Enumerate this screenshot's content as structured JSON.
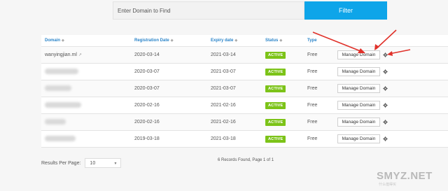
{
  "filter": {
    "placeholder": "Enter Domain to Find",
    "button_label": "Filter"
  },
  "table": {
    "headers": {
      "domain": "Domain",
      "registration_date": "Registration Date",
      "expiry_date": "Expiry date",
      "status": "Status",
      "type": "Type"
    },
    "rows": [
      {
        "domain": "wanyingjian.ml",
        "registration_date": "2020-03-14",
        "expiry_date": "2021-03-14",
        "status": "ACTIVE",
        "type": "Free",
        "manage_label": "Manage Domain"
      },
      {
        "domain": "",
        "registration_date": "2020-03-07",
        "expiry_date": "2021-03-07",
        "status": "ACTIVE",
        "type": "Free",
        "manage_label": "Manage Domain"
      },
      {
        "domain": "",
        "registration_date": "2020-03-07",
        "expiry_date": "2021-03-07",
        "status": "ACTIVE",
        "type": "Free",
        "manage_label": "Manage Domain"
      },
      {
        "domain": "",
        "registration_date": "2020-02-16",
        "expiry_date": "2021-02-16",
        "status": "ACTIVE",
        "type": "Free",
        "manage_label": "Manage Domain"
      },
      {
        "domain": "",
        "registration_date": "2020-02-16",
        "expiry_date": "2021-02-16",
        "status": "ACTIVE",
        "type": "Free",
        "manage_label": "Manage Domain"
      },
      {
        "domain": "",
        "registration_date": "2019-03-18",
        "expiry_date": "2021-03-18",
        "status": "ACTIVE",
        "type": "Free",
        "manage_label": "Manage Domain"
      }
    ]
  },
  "footer": {
    "results_per_page_label": "Results Per Page:",
    "results_per_page_value": "10",
    "records_text": "6 Records Found, Page 1 of 1"
  },
  "watermark": {
    "text": "SMYZ.NET",
    "sub": "什么值得买"
  },
  "colors": {
    "filter_button": "#0ea5e9",
    "status_active": "#7cc318",
    "header_link": "#2a84c9",
    "annotation_arrow": "#e0312a"
  },
  "icons": {
    "sort": "sort-icon",
    "gear": "gear-icon",
    "external_link": "external-link-icon"
  }
}
